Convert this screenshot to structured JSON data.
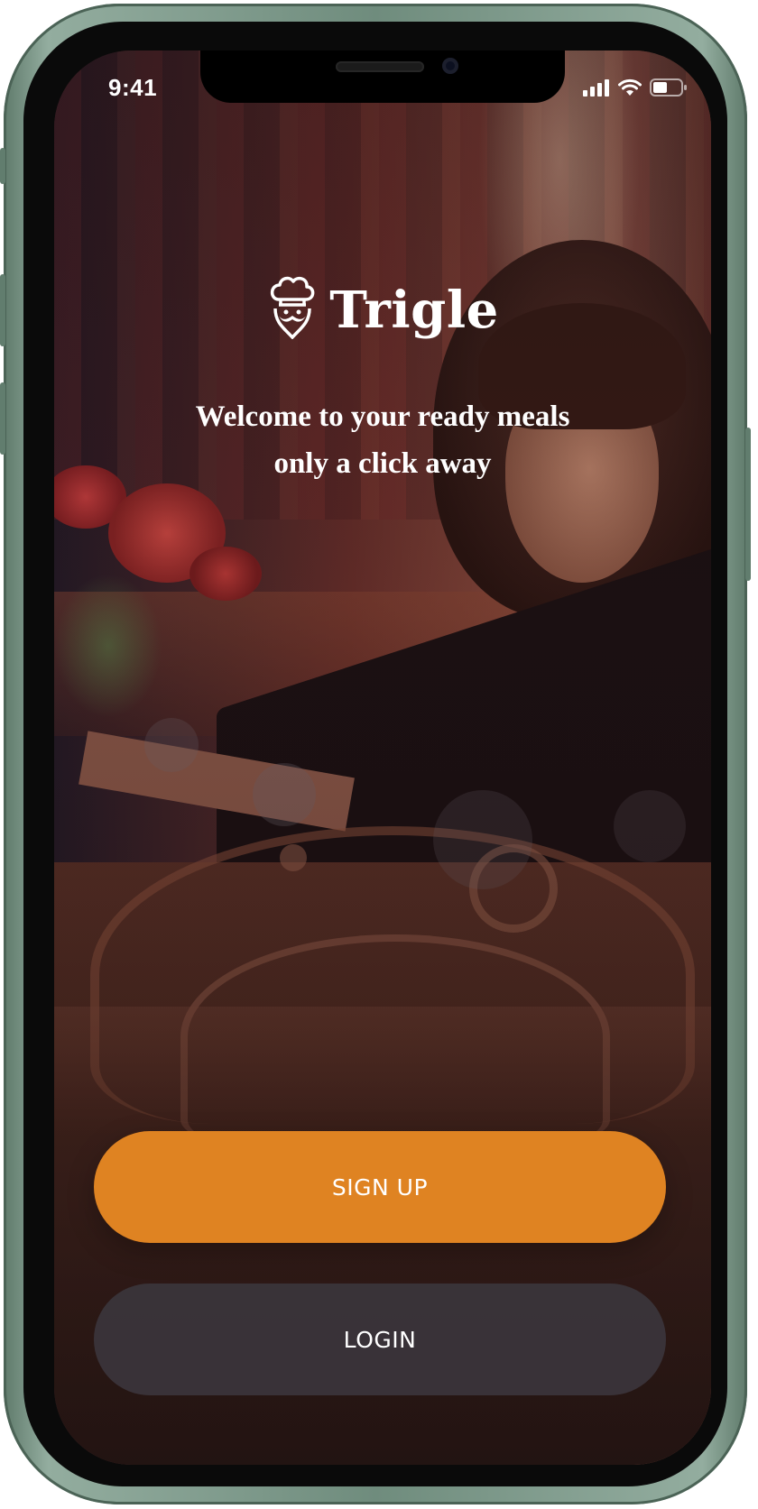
{
  "status_bar": {
    "time": "9:41",
    "icons": [
      "signal-icon",
      "wifi-icon",
      "battery-icon"
    ]
  },
  "app": {
    "brand": "Trigle",
    "logo_icon": "chef-hat-mustache-icon",
    "tagline_line1": "Welcome to your ready meals",
    "tagline_line2": "only a click away"
  },
  "actions": {
    "signup_label": "SIGN UP",
    "login_label": "LOGIN"
  },
  "colors": {
    "primary": "#df8322",
    "secondary_button": "#3a343a",
    "device_frame": "#6f8c7d"
  }
}
